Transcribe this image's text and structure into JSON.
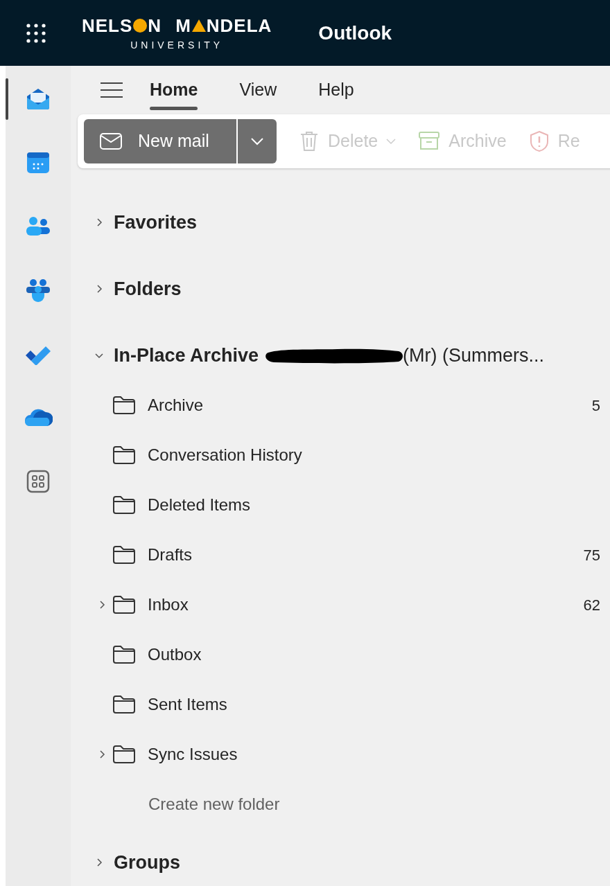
{
  "app_bar": {
    "logo": {
      "name_parts": [
        "NELS",
        "N",
        "M",
        "NDELA"
      ],
      "subtitle": "UNIVERSITY"
    },
    "app_name": "Outlook"
  },
  "rail": [
    {
      "selected": true
    },
    {
      "selected": false
    },
    {
      "selected": false
    },
    {
      "selected": false
    },
    {
      "selected": false
    },
    {
      "selected": false
    },
    {
      "selected": false
    }
  ],
  "tabs": [
    {
      "label": "Home",
      "selected": true
    },
    {
      "label": "View",
      "selected": false
    },
    {
      "label": "Help",
      "selected": false
    }
  ],
  "toolbar": {
    "new_mail": "New mail",
    "actions": [
      {
        "label": "Delete",
        "disabled": true,
        "caret": true
      },
      {
        "label": "Archive",
        "disabled": true,
        "caret": false
      },
      {
        "label": "Re",
        "disabled": true,
        "caret": false
      }
    ]
  },
  "sections": [
    {
      "title": "Favorites",
      "expanded": false
    },
    {
      "title": "Folders",
      "expanded": false
    },
    {
      "title": "In-Place Archive",
      "title_after_redaction": "(Mr) (Summers...",
      "expanded": true,
      "children": [
        {
          "name": "Archive",
          "count": "5",
          "expandable": false
        },
        {
          "name": "Conversation History",
          "expandable": false
        },
        {
          "name": "Deleted Items",
          "expandable": false
        },
        {
          "name": "Drafts",
          "count": "75",
          "expandable": false
        },
        {
          "name": "Inbox",
          "count": "62",
          "expandable": true
        },
        {
          "name": "Outbox",
          "expandable": false
        },
        {
          "name": "Sent Items",
          "expandable": false
        },
        {
          "name": "Sync Issues",
          "expandable": true
        }
      ],
      "create_link": "Create new folder"
    },
    {
      "title": "Groups",
      "expanded": false
    }
  ]
}
